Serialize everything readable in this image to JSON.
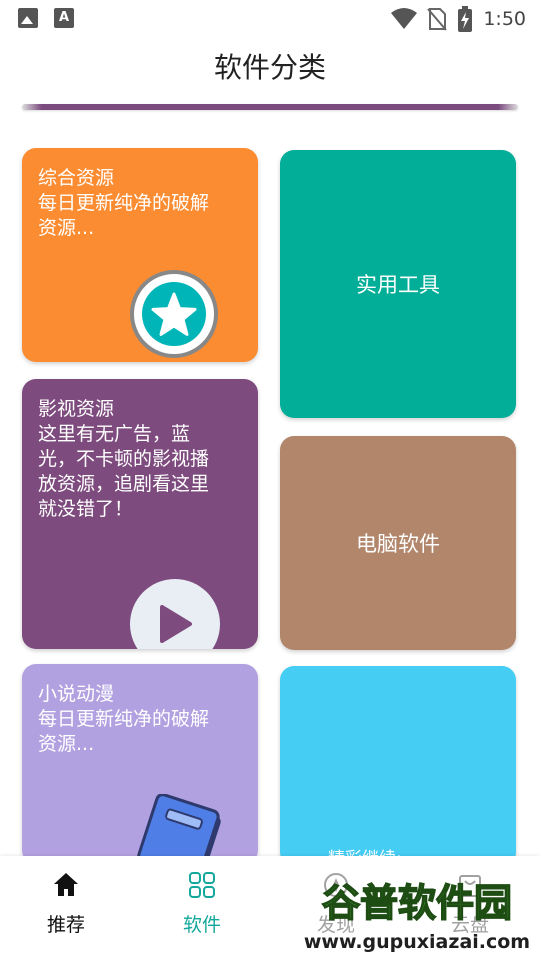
{
  "status_bar": {
    "time": "1:50",
    "icons": [
      "image-icon",
      "text-a-icon",
      "wifi-icon",
      "no-sim-icon",
      "battery-charging-icon"
    ]
  },
  "header": {
    "title": "软件分类"
  },
  "cards": {
    "comprehensive": {
      "text": "综合资源\n每日更新纯净的破解\n资源...",
      "icon": "star-icon",
      "color": "#fb8c32"
    },
    "video": {
      "text": "影视资源\n这里有无广告，蓝\n光，不卡顿的影视播\n放资源，追剧看这里\n就没错了！",
      "icon": "play-icon",
      "color": "#7e4b7e"
    },
    "novel": {
      "text": "小说动漫\n每日更新纯净的破解\n资源...",
      "icon": "book-icon",
      "color": "#b2a1e0"
    },
    "tools": {
      "label": "实用工具",
      "color": "#02ae97"
    },
    "pc": {
      "label": "电脑软件",
      "color": "#b1866b"
    },
    "more": {
      "label": "精彩继续:",
      "color": "#45cdf4"
    }
  },
  "bottom_nav": {
    "items": [
      {
        "label": "推荐",
        "icon": "home-icon",
        "active": false
      },
      {
        "label": "软件",
        "icon": "grid-icon",
        "active": true
      },
      {
        "label": "发现",
        "icon": "compass-icon",
        "active": false
      },
      {
        "label": "云盘",
        "icon": "cloud-bag-icon",
        "active": false
      }
    ],
    "active_color": "#14a89c"
  },
  "watermark": {
    "title": "谷普软件园",
    "url": "www.gupuxiazai.com"
  }
}
